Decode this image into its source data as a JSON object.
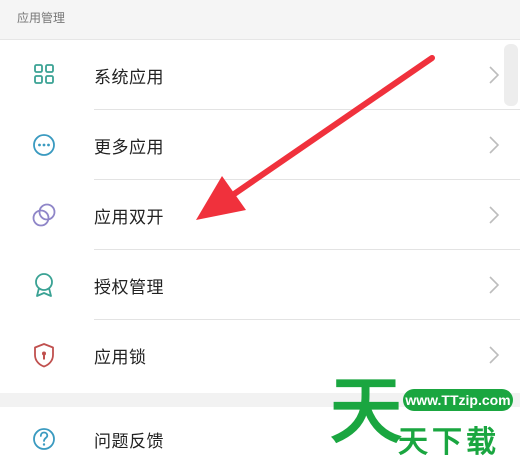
{
  "section": {
    "title": "应用管理"
  },
  "items": [
    {
      "label": "系统应用",
      "icon": "grid-icon"
    },
    {
      "label": "更多应用",
      "icon": "more-dots-icon"
    },
    {
      "label": "应用双开",
      "icon": "dual-circles-icon"
    },
    {
      "label": "授权管理",
      "icon": "badge-icon"
    },
    {
      "label": "应用锁",
      "icon": "shield-lock-icon"
    }
  ],
  "help": {
    "label": "问题反馈",
    "icon": "question-icon"
  },
  "watermark": {
    "big": "天",
    "url": "www.TTzip.com",
    "text": "天下载"
  },
  "colors": {
    "accent": "#3aa294",
    "annotation": "#f0313c",
    "watermark": "#1aa640"
  }
}
